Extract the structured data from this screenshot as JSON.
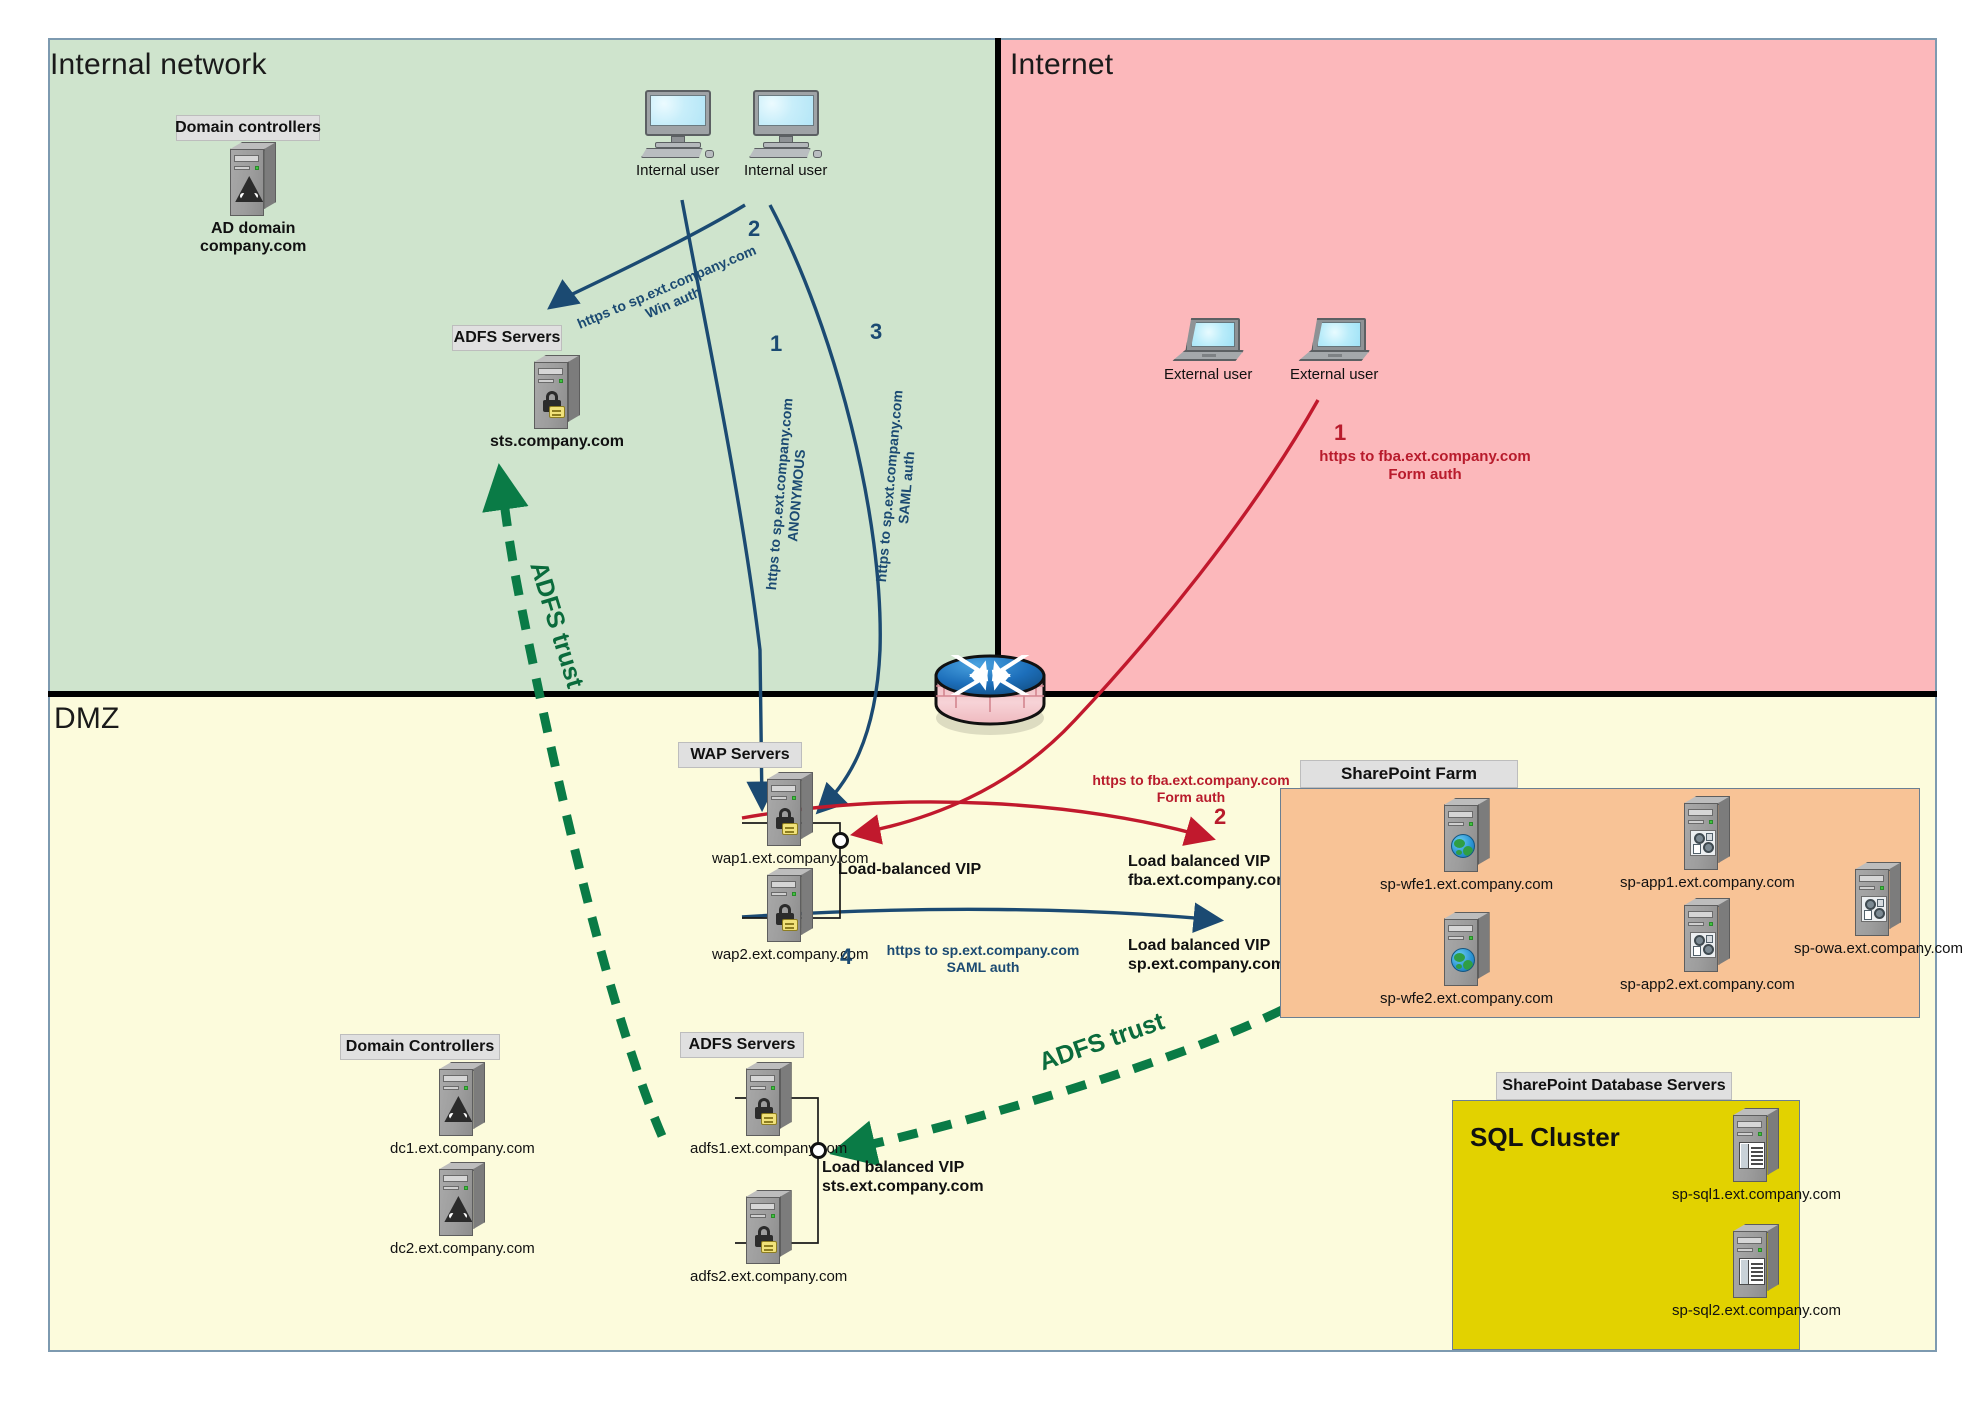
{
  "zones": {
    "internal": {
      "label": "Internal network",
      "color": "#cfe4cd"
    },
    "internet": {
      "label": "Internet",
      "color": "#fcb8bb"
    },
    "dmz": {
      "label": "DMZ",
      "color": "#fcfbdc"
    }
  },
  "groups": {
    "internal_domain_controllers": {
      "title": "Domain controllers"
    },
    "internal_adfs": {
      "title": "ADFS Servers"
    },
    "wap": {
      "title": "WAP Servers"
    },
    "dmz_domain_controllers": {
      "title": "Domain Controllers"
    },
    "dmz_adfs": {
      "title": "ADFS Servers"
    },
    "sharepoint_farm": {
      "title": "SharePoint Farm",
      "color": "#f8c396"
    },
    "sharepoint_db": {
      "title": "SharePoint Database Servers",
      "color": "#e2d200",
      "heading": "SQL Cluster"
    }
  },
  "nodes": {
    "ad_domain": {
      "label": "AD domain\ncompany.com",
      "icon": "server-ad-icon"
    },
    "internal_user_1": {
      "label": "Internal user",
      "icon": "desktop-pc-icon"
    },
    "internal_user_2": {
      "label": "Internal user",
      "icon": "desktop-pc-icon"
    },
    "sts": {
      "label": "sts.company.com",
      "icon": "server-lock-icon"
    },
    "external_user_1": {
      "label": "External user",
      "icon": "laptop-icon"
    },
    "external_user_2": {
      "label": "External user",
      "icon": "laptop-icon"
    },
    "wap1": {
      "label": "wap1.ext.company.com",
      "icon": "server-lock-icon"
    },
    "wap2": {
      "label": "wap2.ext.company.com",
      "icon": "server-lock-icon"
    },
    "dc1": {
      "label": "dc1.ext.company.com",
      "icon": "server-ad-icon"
    },
    "dc2": {
      "label": "dc2.ext.company.com",
      "icon": "server-ad-icon"
    },
    "adfs1": {
      "label": "adfs1.ext.company.com",
      "icon": "server-lock-icon"
    },
    "adfs2": {
      "label": "adfs2.ext.company.com",
      "icon": "server-lock-icon"
    },
    "sp_wfe1": {
      "label": "sp-wfe1.ext.company.com",
      "icon": "server-globe-icon"
    },
    "sp_wfe2": {
      "label": "sp-wfe2.ext.company.com",
      "icon": "server-globe-icon"
    },
    "sp_app1": {
      "label": "sp-app1.ext.company.com",
      "icon": "server-gear-icon"
    },
    "sp_app2": {
      "label": "sp-app2.ext.company.com",
      "icon": "server-gear-icon"
    },
    "sp_owa": {
      "label": "sp-owa.ext.company.com",
      "icon": "server-gear-icon"
    },
    "sp_sql1": {
      "label": "sp-sql1.ext.company.com",
      "icon": "server-db-icon"
    },
    "sp_sql2": {
      "label": "sp-sql2.ext.company.com",
      "icon": "server-db-icon"
    },
    "firewall": {
      "label": "",
      "icon": "firewall-icon"
    }
  },
  "vips": {
    "wap_vip": {
      "label": "Load-balanced VIP"
    },
    "fba_vip": {
      "label": "Load balanced VIP\nfba.ext.company.com"
    },
    "sp_vip": {
      "label": "Load balanced VIP\nsp.ext.company.com"
    },
    "sts_vip": {
      "label": "Load balanced VIP\nsts.ext.company.com"
    }
  },
  "flows": [
    {
      "id": "internal-1",
      "number": "1",
      "label": "https to sp.ext.company.com\nANONYMOUS",
      "color": "#1b4a72"
    },
    {
      "id": "internal-2",
      "number": "2",
      "label": "https to sp.ext.company.com\nWin auth",
      "color": "#1b4a72"
    },
    {
      "id": "internal-3",
      "number": "3",
      "label": "https to sp.ext.company.com\nSAML auth",
      "color": "#1b4a72"
    },
    {
      "id": "internal-4",
      "number": "4",
      "label": "https to sp.ext.company.com\nSAML auth",
      "color": "#1b4a72"
    },
    {
      "id": "external-1",
      "number": "1",
      "label": "https to fba.ext.company.com\nForm auth",
      "color": "#b81b2c"
    },
    {
      "id": "external-2",
      "number": "2",
      "label": "https to fba.ext.company.com\nForm auth",
      "color": "#b81b2c"
    }
  ],
  "trust": {
    "label_top": "ADFS trust",
    "label_bottom": "ADFS trust",
    "color": "#0a6b3c"
  }
}
